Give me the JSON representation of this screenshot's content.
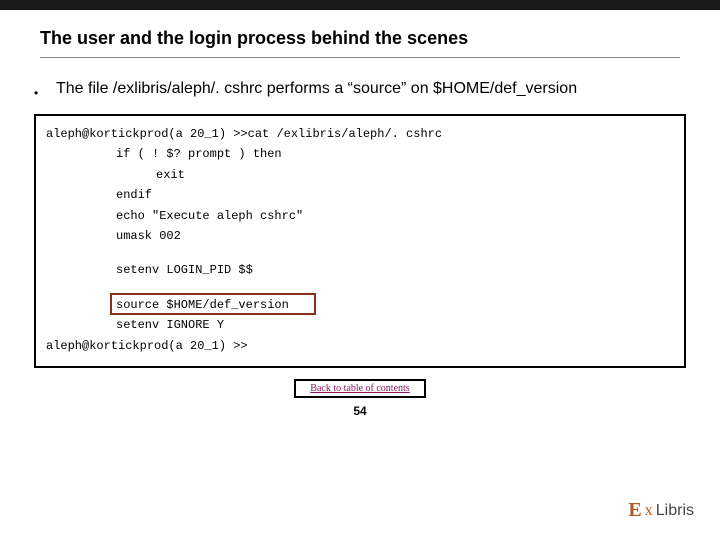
{
  "slide": {
    "title": "The user and the login process behind the scenes",
    "bulletText": "The file /exlibris/aleph/. cshrc performs a “source” on $HOME/def_version",
    "pageNumber": "54"
  },
  "code": {
    "line1": "aleph@kortickprod(a 20_1) >>cat /exlibris/aleph/. cshrc",
    "line2": "if ( ! $? prompt ) then",
    "line3": "exit",
    "line4": "endif",
    "line5": "echo \"Execute aleph  cshrc\"",
    "line6": "umask 002",
    "line7": "setenv LOGIN_PID $$",
    "line8": "source $HOME/def_version",
    "line9": "setenv IGNORE Y",
    "line10": "aleph@kortickprod(a 20_1) >>"
  },
  "nav": {
    "backLink": "Back to table of contents"
  },
  "logo": {
    "name": "ExLibris"
  }
}
